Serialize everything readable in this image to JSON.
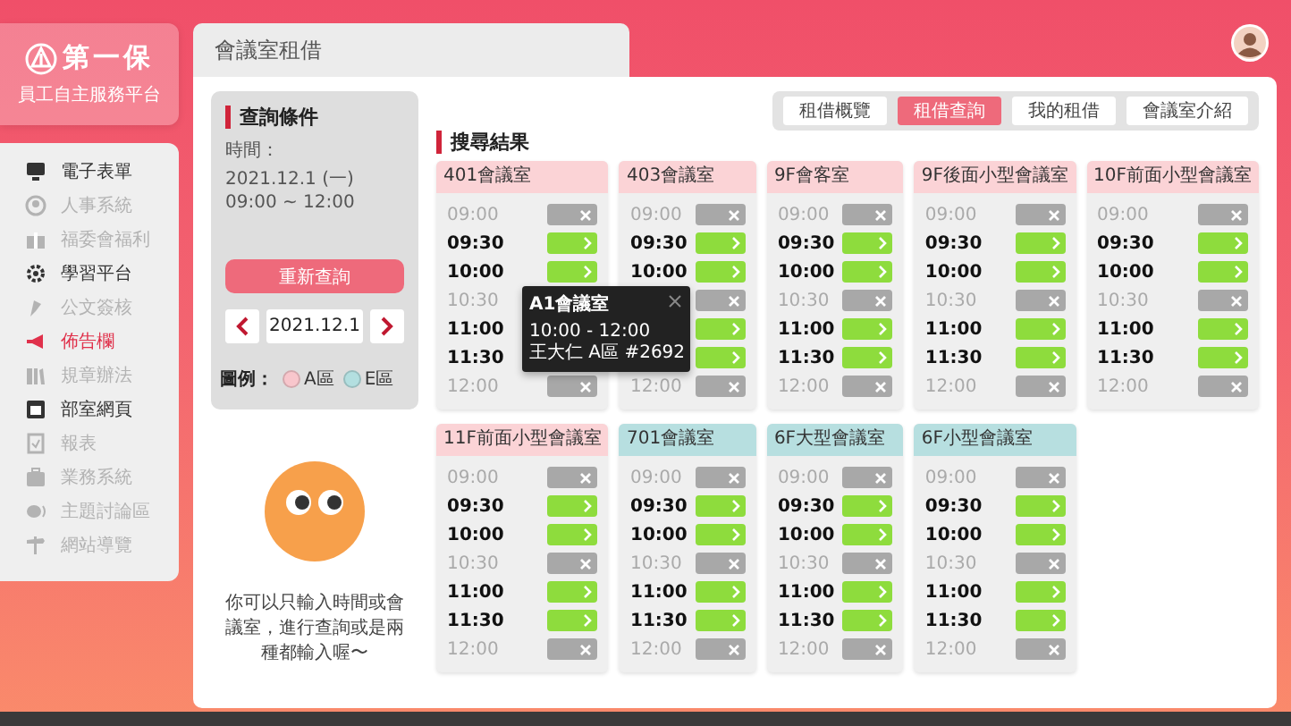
{
  "logo": {
    "title": "第一保",
    "subtitle": "員工自主服務平台"
  },
  "sidebar": {
    "items": [
      {
        "label": "電子表單",
        "selected": false,
        "disabled": false
      },
      {
        "label": "人事系統",
        "selected": false,
        "disabled": true
      },
      {
        "label": "福委會福利",
        "selected": false,
        "disabled": true
      },
      {
        "label": "學習平台",
        "selected": false,
        "disabled": false
      },
      {
        "label": "公文簽核",
        "selected": false,
        "disabled": true
      },
      {
        "label": "佈告欄",
        "selected": true,
        "disabled": false
      },
      {
        "label": "規章辦法",
        "selected": false,
        "disabled": true
      },
      {
        "label": "部室網頁",
        "selected": false,
        "disabled": false
      },
      {
        "label": "報表",
        "selected": false,
        "disabled": true
      },
      {
        "label": "業務系統",
        "selected": false,
        "disabled": true
      },
      {
        "label": "主題討論區",
        "selected": false,
        "disabled": true
      },
      {
        "label": "網站導覽",
        "selected": false,
        "disabled": true
      }
    ]
  },
  "page": {
    "title": "會議室租借"
  },
  "query": {
    "title": "查詢條件",
    "time_label": "時間：",
    "time_value": "2021.12.1 (一) 09:00 ~ 12:00",
    "button": "重新查詢",
    "date": "2021.12.1",
    "legend": {
      "label": "圖例：",
      "items": [
        {
          "label": "A區",
          "color": "#f8c6cc"
        },
        {
          "label": "E區",
          "color": "#b3dfe0"
        }
      ]
    },
    "hint": "你可以只輸入時間或會議室，進行查詢或是兩種都輸入喔〜"
  },
  "tabs": [
    {
      "label": "租借概覽",
      "selected": false
    },
    {
      "label": "租借查詢",
      "selected": true
    },
    {
      "label": "我的租借",
      "selected": false
    },
    {
      "label": "會議室介紹",
      "selected": false
    }
  ],
  "results": {
    "title": "搜尋結果",
    "rooms": [
      {
        "name": "401會議室",
        "color": "#fbd3d6",
        "slots": [
          {
            "time": "09:00",
            "available": false
          },
          {
            "time": "09:30",
            "available": true
          },
          {
            "time": "10:00",
            "available": true
          },
          {
            "time": "10:30",
            "available": false
          },
          {
            "time": "11:00",
            "available": true
          },
          {
            "time": "11:30",
            "available": true
          },
          {
            "time": "12:00",
            "available": false
          }
        ]
      },
      {
        "name": "403會議室",
        "color": "#fbd3d6",
        "slots": [
          {
            "time": "09:00",
            "available": false
          },
          {
            "time": "09:30",
            "available": true
          },
          {
            "time": "10:00",
            "available": true
          },
          {
            "available": false
          },
          {
            "available": true
          },
          {
            "available": true
          },
          {
            "time": "12:00",
            "available": false
          }
        ]
      },
      {
        "name": "9F會客室",
        "color": "#fbd3d6",
        "slots": [
          {
            "time": "09:00",
            "available": false
          },
          {
            "time": "09:30",
            "available": true
          },
          {
            "time": "10:00",
            "available": true
          },
          {
            "time": "10:30",
            "available": false
          },
          {
            "time": "11:00",
            "available": true
          },
          {
            "time": "11:30",
            "available": true
          },
          {
            "time": "12:00",
            "available": false
          }
        ]
      },
      {
        "name": "9F後面小型會議室",
        "color": "#fbd3d6",
        "slots": [
          {
            "time": "09:00",
            "available": false
          },
          {
            "time": "09:30",
            "available": true
          },
          {
            "time": "10:00",
            "available": true
          },
          {
            "time": "10:30",
            "available": false
          },
          {
            "time": "11:00",
            "available": true
          },
          {
            "time": "11:30",
            "available": true
          },
          {
            "time": "12:00",
            "available": false
          }
        ]
      },
      {
        "name": "10F前面小型會議室",
        "color": "#fbd3d6",
        "slots": [
          {
            "time": "09:00",
            "available": false
          },
          {
            "time": "09:30",
            "available": true
          },
          {
            "time": "10:00",
            "available": true
          },
          {
            "time": "10:30",
            "available": false
          },
          {
            "time": "11:00",
            "available": true
          },
          {
            "time": "11:30",
            "available": true
          },
          {
            "time": "12:00",
            "available": false
          }
        ]
      },
      {
        "name": "11F前面小型會議室",
        "color": "#fbd3d6",
        "slots": [
          {
            "time": "09:00",
            "available": false
          },
          {
            "time": "09:30",
            "available": true
          },
          {
            "time": "10:00",
            "available": true
          },
          {
            "time": "10:30",
            "available": false
          },
          {
            "time": "11:00",
            "available": true
          },
          {
            "time": "11:30",
            "available": true
          },
          {
            "time": "12:00",
            "available": false
          }
        ]
      },
      {
        "name": "701會議室",
        "color": "#b7dfe0",
        "slots": [
          {
            "time": "09:00",
            "available": false
          },
          {
            "time": "09:30",
            "available": true
          },
          {
            "time": "10:00",
            "available": true
          },
          {
            "time": "10:30",
            "available": false
          },
          {
            "time": "11:00",
            "available": true
          },
          {
            "time": "11:30",
            "available": true
          },
          {
            "time": "12:00",
            "available": false
          }
        ]
      },
      {
        "name": "6F大型會議室",
        "color": "#b7dfe0",
        "slots": [
          {
            "time": "09:00",
            "available": false
          },
          {
            "time": "09:30",
            "available": true
          },
          {
            "time": "10:00",
            "available": true
          },
          {
            "time": "10:30",
            "available": false
          },
          {
            "time": "11:00",
            "available": true
          },
          {
            "time": "11:30",
            "available": true
          },
          {
            "time": "12:00",
            "available": false
          }
        ]
      },
      {
        "name": "6F小型會議室",
        "color": "#b7dfe0",
        "slots": [
          {
            "time": "09:00",
            "available": false
          },
          {
            "time": "09:30",
            "available": true
          },
          {
            "time": "10:00",
            "available": true
          },
          {
            "time": "10:30",
            "available": false
          },
          {
            "time": "11:00",
            "available": true
          },
          {
            "time": "11:30",
            "available": true
          },
          {
            "time": "12:00",
            "available": false
          }
        ]
      }
    ]
  },
  "tooltip": {
    "title": "A1會議室",
    "time": "10:00 - 12:00",
    "detail": "王大仁 A區 #2692"
  }
}
